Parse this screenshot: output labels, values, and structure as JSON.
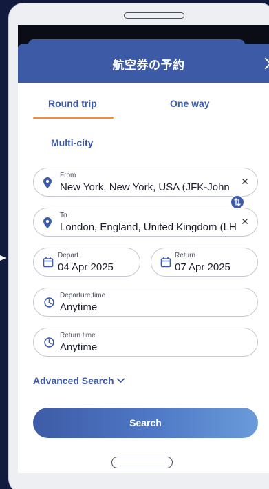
{
  "modal": {
    "title": "航空券の予約",
    "close_icon": "close-icon"
  },
  "tabs": [
    {
      "label": "Round trip",
      "active": true
    },
    {
      "label": "One way",
      "active": false
    },
    {
      "label": "Multi-city",
      "active": false
    }
  ],
  "from": {
    "label": "From",
    "value": "New York, New York, USA (JFK-John"
  },
  "to": {
    "label": "To",
    "value": "London, England, United Kingdom (LH"
  },
  "depart": {
    "label": "Depart",
    "value": "04 Apr 2025"
  },
  "return": {
    "label": "Return",
    "value": "07 Apr 2025"
  },
  "departure_time": {
    "label": "Departure time",
    "value": "Anytime"
  },
  "return_time": {
    "label": "Return time",
    "value": "Anytime"
  },
  "advanced_search": {
    "label": "Advanced Search"
  },
  "search_button": {
    "label": "Search"
  },
  "colors": {
    "brand": "#3d5aa6",
    "accent_underline": "#f0902c",
    "background": "#121a3e"
  }
}
